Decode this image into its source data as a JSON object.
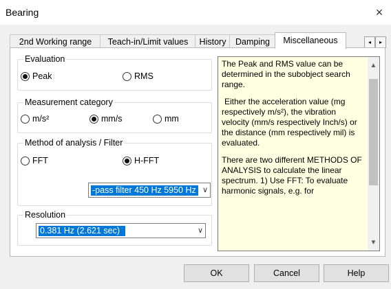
{
  "window": {
    "title": "Bearing",
    "close_glyph": "×"
  },
  "tabs": [
    {
      "label": "2nd Working range",
      "active": false
    },
    {
      "label": "Teach-in/Limit values",
      "active": false
    },
    {
      "label": "History",
      "active": false
    },
    {
      "label": "Damping",
      "active": false
    },
    {
      "label": "Miscellaneous",
      "active": true
    }
  ],
  "tab_scroll": {
    "left": "◂",
    "right": "▸"
  },
  "evaluation": {
    "legend": "Evaluation",
    "options": [
      {
        "label": "Peak",
        "selected": true
      },
      {
        "label": "RMS",
        "selected": false
      }
    ]
  },
  "measurement": {
    "legend": "Measurement category",
    "options": [
      {
        "label": "m/s²",
        "selected": false
      },
      {
        "label": "mm/s",
        "selected": true
      },
      {
        "label": "mm",
        "selected": false
      }
    ]
  },
  "method": {
    "legend": "Method of analysis / Filter",
    "options": [
      {
        "label": "FFT",
        "selected": false
      },
      {
        "label": "H-FFT",
        "selected": true
      }
    ],
    "filter_value": "-pass filter 450 Hz 5950 Hz"
  },
  "resolution": {
    "legend": "Resolution",
    "value": "0.381 Hz (2.621 sec)"
  },
  "help": {
    "paragraphs": [
      "The Peak and RMS value can be determined in the subobject search range.",
      "Either the acceleration value (mg respectively m/s²), the vibration velocity (mm/s respectively Inch/s) or the distance (mm respectively mil) is evaluated.",
      "There are two different METHODS OF ANALYSIS to calculate the linear spectrum. 1) Use FFT: To evaluate harmonic signals, e.g. for"
    ],
    "scroll_up": "▲",
    "scroll_down": "▼"
  },
  "icons": {
    "dropdown": "chevron-down-icon",
    "close": "close-icon"
  },
  "buttons": {
    "ok": "OK",
    "cancel": "Cancel",
    "help": "Help"
  }
}
